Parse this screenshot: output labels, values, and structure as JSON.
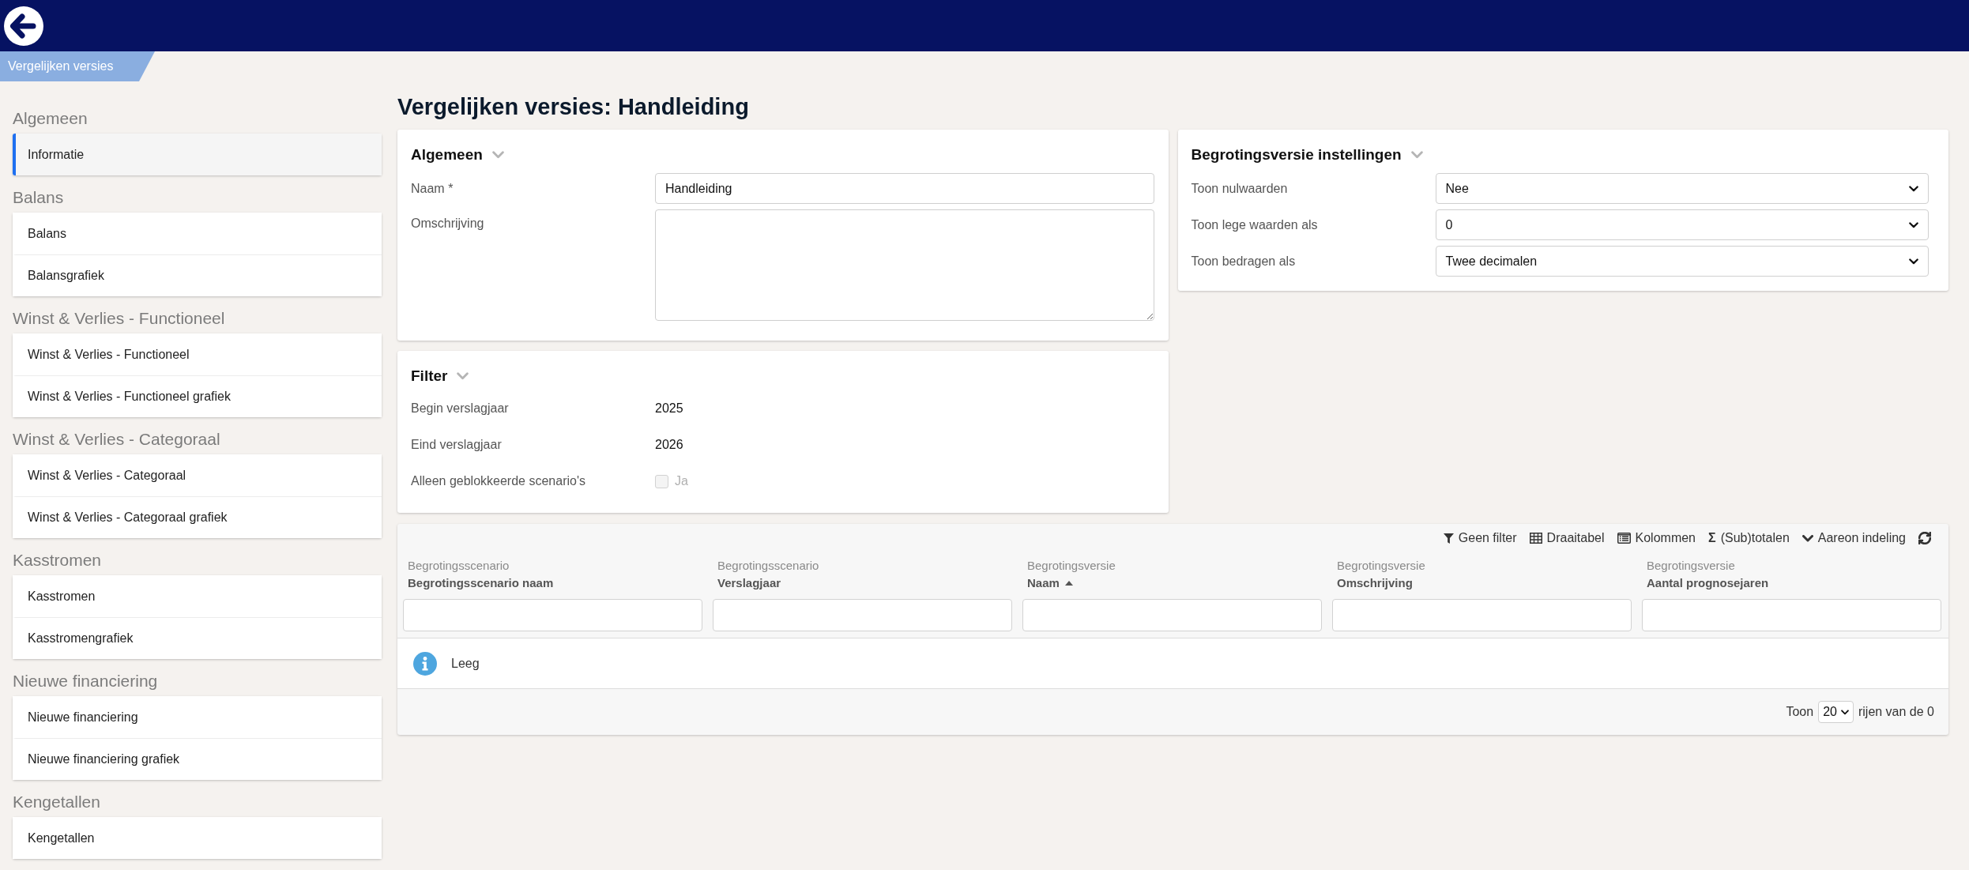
{
  "breadcrumb": {
    "label": "Vergelijken versies"
  },
  "sidebar": {
    "groups": [
      {
        "title": "Algemeen",
        "items": [
          {
            "label": "Informatie",
            "selected": true
          }
        ]
      },
      {
        "title": "Balans",
        "items": [
          {
            "label": "Balans",
            "selected": false
          },
          {
            "label": "Balansgrafiek",
            "selected": false
          }
        ]
      },
      {
        "title": "Winst & Verlies - Functioneel",
        "items": [
          {
            "label": "Winst & Verlies - Functioneel",
            "selected": false
          },
          {
            "label": "Winst & Verlies - Functioneel grafiek",
            "selected": false
          }
        ]
      },
      {
        "title": "Winst & Verlies - Categoraal",
        "items": [
          {
            "label": "Winst & Verlies - Categoraal",
            "selected": false
          },
          {
            "label": "Winst & Verlies - Categoraal grafiek",
            "selected": false
          }
        ]
      },
      {
        "title": "Kasstromen",
        "items": [
          {
            "label": "Kasstromen",
            "selected": false
          },
          {
            "label": "Kasstromengrafiek",
            "selected": false
          }
        ]
      },
      {
        "title": "Nieuwe financiering",
        "items": [
          {
            "label": "Nieuwe financiering",
            "selected": false
          },
          {
            "label": "Nieuwe financiering grafiek",
            "selected": false
          }
        ]
      },
      {
        "title": "Kengetallen",
        "items": [
          {
            "label": "Kengetallen",
            "selected": false
          }
        ]
      }
    ]
  },
  "page_title": "Vergelijken versies: Handleiding",
  "general_section": {
    "title": "Algemeen",
    "fields": [
      {
        "kind": "input",
        "label": "Naam *",
        "value": "Handleiding"
      },
      {
        "kind": "textarea",
        "label": "Omschrijving"
      }
    ]
  },
  "filter_section": {
    "title": "Filter",
    "fields": [
      {
        "kind": "text",
        "label": "Begin verslagjaar",
        "value": "2025"
      },
      {
        "kind": "text",
        "label": "Eind verslagjaar",
        "value": "2026"
      },
      {
        "kind": "checkbox",
        "label": "Alleen geblokkeerde scenario's",
        "option": "Ja",
        "checked": false,
        "disabled": true
      }
    ]
  },
  "settings_section": {
    "title": "Begrotingsversie instellingen",
    "fields": [
      {
        "kind": "select",
        "label": "Toon nulwaarden",
        "value": "Nee"
      },
      {
        "kind": "select",
        "label": "Toon lege waarden als",
        "value": "0"
      },
      {
        "kind": "select",
        "label": "Toon bedragen als",
        "value": "Twee decimalen"
      }
    ]
  },
  "table": {
    "toolbar": [
      {
        "kind": "filter",
        "label": "Geen filter"
      },
      {
        "kind": "pivot",
        "label": "Draaitabel"
      },
      {
        "kind": "columns",
        "label": "Kolommen"
      },
      {
        "kind": "totals",
        "symbol": "Σ",
        "label": "(Sub)totalen"
      },
      {
        "kind": "layout",
        "label": "Aareon indeling"
      },
      {
        "kind": "refresh"
      }
    ],
    "columns": [
      {
        "group": "Begrotingsscenario",
        "name": "Begrotingsscenario naam",
        "sorted": false
      },
      {
        "group": "Begrotingsscenario",
        "name": "Verslagjaar",
        "sorted": false
      },
      {
        "group": "Begrotingsversie",
        "name": "Naam",
        "sorted": true
      },
      {
        "group": "Begrotingsversie",
        "name": "Omschrijving",
        "sorted": false
      },
      {
        "group": "Begrotingsversie",
        "name": "Aantal prognosejaren",
        "sorted": false
      }
    ],
    "empty_message": "Leeg",
    "pagination": {
      "prefix": "Toon",
      "page_size": "20",
      "suffix": "rijen van de 0"
    }
  }
}
